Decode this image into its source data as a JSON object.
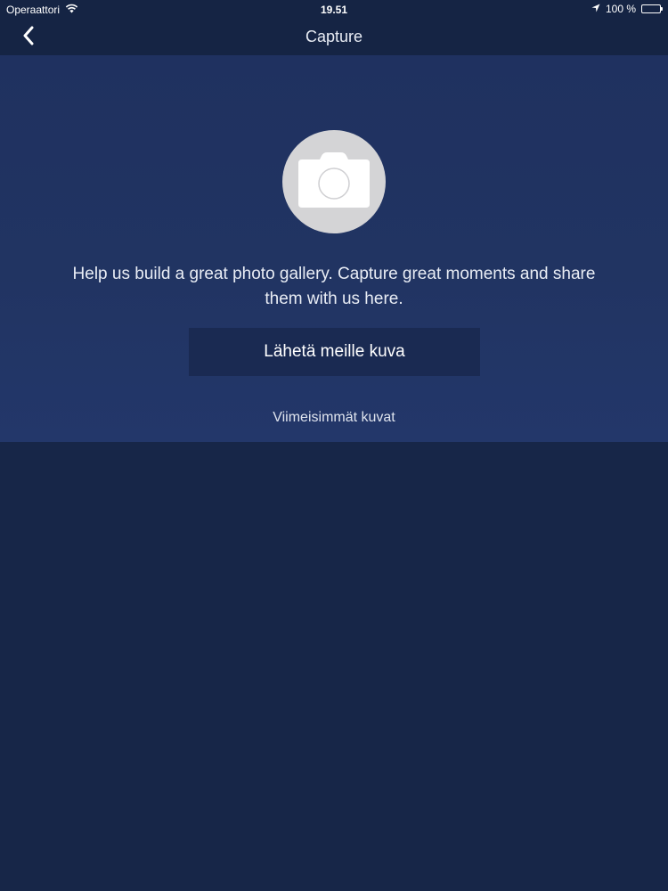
{
  "status_bar": {
    "carrier": "Operaattori",
    "time": "19.51",
    "battery": "100 %"
  },
  "nav": {
    "title": "Capture",
    "back_icon": "chevron-left-icon"
  },
  "hero": {
    "icon": "camera-icon",
    "helper_text": "Help us build a great photo gallery. Capture great moments and share them with us here.",
    "send_button_label": "Lähetä meille kuva",
    "recent_label": "Viimeisimmät kuvat"
  },
  "colors": {
    "background": "#172648",
    "hero_background": "#213462",
    "button_background": "#1a2a52",
    "camera_circle": "#d4d4d6"
  }
}
